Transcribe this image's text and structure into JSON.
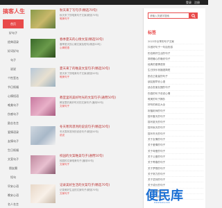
{
  "topbar": {
    "login": "登录",
    "register": "注册"
  },
  "site": {
    "brand": "搞客人生"
  },
  "nav": [
    {
      "label": "首页",
      "active": true
    },
    {
      "label": "好句子"
    },
    {
      "label": "经典语录"
    },
    {
      "label": "好词好句"
    },
    {
      "label": "句子"
    },
    {
      "label": "说说"
    },
    {
      "label": "个性签名"
    },
    {
      "label": "节日祝福"
    },
    {
      "label": "心情短语"
    },
    {
      "label": "唯美句子"
    },
    {
      "label": "伤感句子"
    },
    {
      "label": "励志名言"
    },
    {
      "label": "爱情语录"
    },
    {
      "label": "友情句子"
    },
    {
      "label": "生日祝福"
    },
    {
      "label": "文案句子"
    },
    {
      "label": "朋友圈"
    },
    {
      "label": "短句"
    },
    {
      "label": "早安心语"
    },
    {
      "label": "晚安心语"
    },
    {
      "label": "名人名言"
    },
    {
      "label": "鸡汤句子"
    }
  ],
  "posts": [
    {
      "title": "秋天来了写句子(精选70句)",
      "desc": "秋天来了的唯美句子文案(精选70句)",
      "tag": "唯美句子",
      "colors": [
        "#8a9a4a",
        "#c9b86a",
        "#5e7a3a"
      ]
    },
    {
      "title": "春季夏天的心情文案(精选50句)",
      "desc": "春季夏天的心情文案及短句(精选50句)",
      "tag": "心情短语",
      "colors": [
        "#3a6a2a",
        "#6a9a4a",
        "#2a4a1a"
      ]
    },
    {
      "title": "夏天来了的唯美文案句子(精选50句)",
      "desc": "夏天来了的唯美句子文案(精选50句)",
      "tag": "唯美句子",
      "colors": [
        "#b8c8d8",
        "#e8e0d0",
        "#9ab0c0"
      ]
    },
    {
      "title": "教室里的美好时光的文案句子(通用50句)",
      "desc": "教室里的美好时光的文案句子(通用50句)",
      "tag": "文案句子",
      "colors": [
        "#c87aa0",
        "#e8b0c8",
        "#a85a80"
      ]
    },
    {
      "title": "冬天寒风凛冽的说说句子(精选50句)",
      "desc": "冬天寒风凛冽的说说句子(精选50句)",
      "tag": "说说",
      "colors": [
        "#d0d8e0",
        "#a8b8c8",
        "#f0f0f0"
      ]
    },
    {
      "title": "校园的文案唯美句子(通用50句)",
      "desc": "校园的文案唯美句子(通用50句)",
      "tag": "文案句子",
      "colors": [
        "#c08aa0",
        "#e8c0d0",
        "#8a5a70"
      ]
    },
    {
      "title": "记录美好生活的文案句子(精选70句)",
      "desc": "记录美好生活的文案句子(精选70句)",
      "tag": "文案句子",
      "colors": [
        "#e8d8c8",
        "#f8f0e8",
        "#c8b8a8"
      ]
    }
  ],
  "sidebar": {
    "search_placeholder": "请输入关键字搜索",
    "title": "标签",
    "items": [
      "2022毕业季的句子文案",
      "抖音好句子一句话伤感",
      "形容美好生活的句子",
      "简短暖心的晚安句子",
      "经典的爱情语录",
      "生日快乐祝福语简短",
      "励志正能量的句子",
      "朋友圈早安心语",
      "适合发朋友圈的句子",
      "伤感的句子说说心情",
      "唯美的句子摘抄",
      "好听的网名大全",
      "祝福老师的句子",
      "描写春天的句子",
      "描写夏天的句子",
      "描写秋天的句子",
      "描写冬天的句子",
      "关于友情的句子",
      "关于爱情的句子",
      "关于母爱的句子",
      "关于父爱的句子",
      "关于青春的句子",
      "关于梦想的句子",
      "关于努力的句子",
      "关于坚持的句子",
      "关于成长的句子",
      "关于时间的句子",
      "关于读书的句子"
    ]
  },
  "watermark": {
    "text": "便民库",
    "sub": "bianminku.com"
  },
  "colors": {
    "accent": "#e84a4a",
    "topbar": "#222222",
    "watermark": "#1a6fd4"
  }
}
